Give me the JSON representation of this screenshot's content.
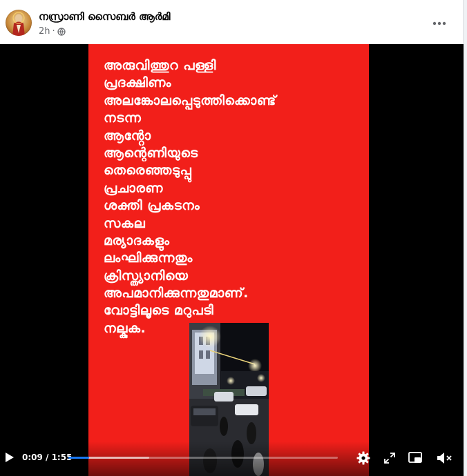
{
  "post": {
    "page_name": "നസ്രാണി സൈബർ ആർമി",
    "timestamp": "2h",
    "separator": "·",
    "privacy_icon": "globe-icon",
    "more_icon": "more-horizontal-icon"
  },
  "video": {
    "overlay_lines": [
      "അരുവിത്തുറ പള്ളി",
      "പ്രദക്ഷിണം",
      "അലങ്കോലപ്പെടുത്തിക്കൊണ്ട്",
      "നടന്ന",
      "ആൻ്റോ",
      "ആന്റെണിയുടെ",
      "തെരെഞ്ഞടുപ്പു",
      "പ്രചാരണ",
      "ശക്തി പ്രകടനം",
      "സകല",
      "മര്യാദകളും",
      "ലംഘിക്കുന്നതും",
      "ക്രിസ്ത്യാനിയെ",
      "അപമാനിക്കുന്നതുമാണ്.",
      "വോട്ടിലൂടെ മറുപടി",
      "നല്കുക."
    ],
    "background_color": "#f21f1a",
    "controls": {
      "time_display": "0:09 / 1:55",
      "played_fraction": 0.078,
      "buffered_fraction": 0.3,
      "play_icon": "play-icon",
      "settings_icon": "gear-icon",
      "fullscreen_icon": "fullscreen-icon",
      "pip_icon": "picture-in-picture-icon",
      "volume_icon": "volume-muted-icon"
    }
  },
  "colors": {
    "progress_played": "#1877f2",
    "text_primary": "#050505",
    "text_secondary": "#65676b"
  }
}
